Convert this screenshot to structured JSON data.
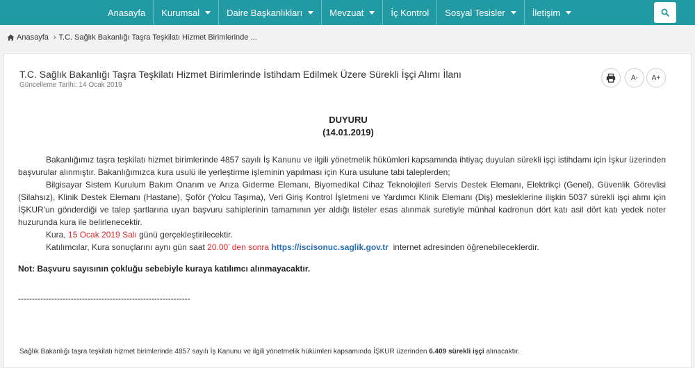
{
  "nav": {
    "items": [
      {
        "label": "Anasayfa",
        "has_caret": false
      },
      {
        "label": "Kurumsal",
        "has_caret": true
      },
      {
        "label": "Daire Başkanlıkları",
        "has_caret": true
      },
      {
        "label": "Mevzuat",
        "has_caret": true
      },
      {
        "label": "İç Kontrol",
        "has_caret": false
      },
      {
        "label": "Sosyal Tesisler",
        "has_caret": true
      },
      {
        "label": "İletişim",
        "has_caret": true
      }
    ],
    "search_icon": "search-icon",
    "bg_color": "#219aa3"
  },
  "breadcrumb": {
    "home_icon": "home-icon",
    "home": "Anasayfa",
    "current": "T.C. Sağlık Bakanlığı Taşra Teşkilatı Hizmet Birimlerinde ..."
  },
  "article": {
    "title": "T.C. Sağlık Bakanlığı Taşra Teşkilatı Hizmet Birimlerinde İstihdam Edilmek Üzere Sürekli İşçi Alımı İlanı",
    "update_label": "Güncelleme Tarihi:",
    "update_date": "14 Ocak 2019",
    "tools": {
      "print_icon": "printer-icon",
      "font_decrease": "A-",
      "font_increase": "A+"
    }
  },
  "announcement": {
    "heading": "DUYURU",
    "date": "(14.01.2019)",
    "para1": "Bakanlığımız taşra teşkilatı hizmet birimlerinde 4857 sayılı İş Kanunu ve ilgili yönetmelik hükümleri kapsamında ihtiyaç duyulan sürekli işçi istihdamı için İşkur üzerinden başvurular alınmıştır. Bakanlığımızca kura usulü ile yerleştirme işleminin yapılması için Kura usulune tabi taleplerden;",
    "para2": "Bilgisayar Sistem Kurulum Bakım Onarım ve Arıza Giderme Elemanı, Biyomedikal Cihaz Teknolojileri Servis Destek Elemanı, Elektrikçi (Genel), Güvenlik Görevlisi (Silahsız), Klinik Destek Elemanı (Hastane), Şoför (Yolcu Taşıma), Veri Giriş Kontrol İşletmeni ve Yardımcı Klinik Elemanı (Diş) mesleklerine ilişkin 5037 sürekli işçi alımı için İŞKUR'un gönderdiği ve talep şartlarına uyan başvuru sahiplerinin tamamının yer aldığı listeler esas alınmak suretiyle münhal kadronun dört katı asil dört katı yedek noter huzurunda kura ile belirlenecektir.",
    "para3_prefix": "Kura,",
    "para3_date": "15 Ocak 2019 Salı",
    "para3_suffix": "günü gerçekleştirilecektir.",
    "para4_prefix": "Katılımcılar, Kura sonuçlarını aynı gün saat",
    "para4_time": "20.00’ den sonra",
    "para4_link": "https://iscisonuc.saglik.gov.tr",
    "para4_suffix": "internet adresinden öğrenebileceklerdir.",
    "note": "Not: Başvuru sayısının çokluğu sebebiyle kuraya katılımcı alınmayacaktır.",
    "separator": "--------------------------------------------------------------",
    "footer_prefix": "Sağlık Bakanlığı taşra teşkilatı hizmet birimlerinde 4857 sayılı İş Kanunu ve ilgili yönetmelik hükümleri kapsamında İŞKUR üzerinden",
    "footer_bold": "6.409 sürekli işçi",
    "footer_suffix": "alınacaktır."
  }
}
